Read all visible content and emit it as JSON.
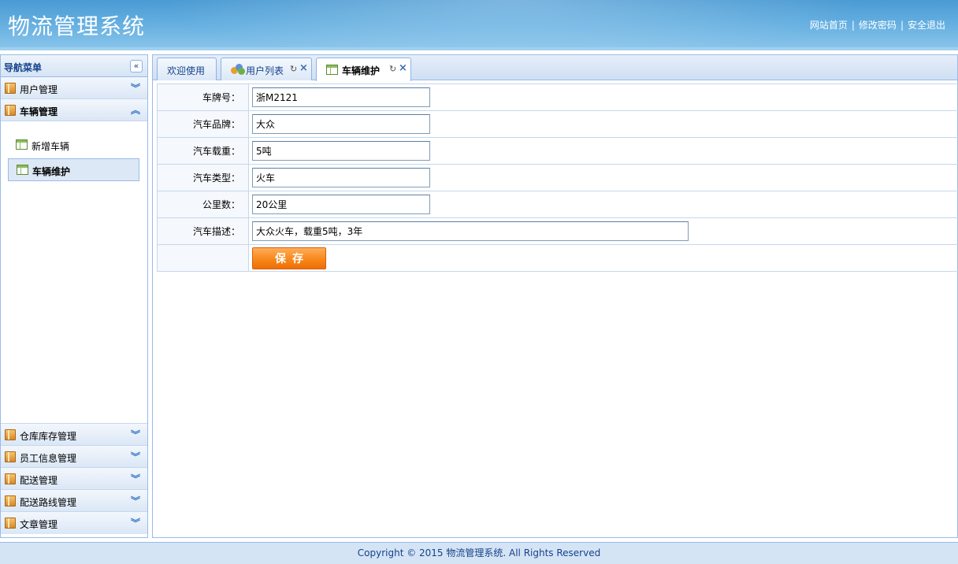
{
  "header": {
    "title": "物流管理系统",
    "links": [
      "网站首页",
      "修改密码",
      "安全退出"
    ],
    "separator": "|"
  },
  "sidebar": {
    "title": "导航菜单",
    "collapse_icon": "«",
    "sections_top": [
      {
        "label": "用户管理",
        "expanded": false
      },
      {
        "label": "车辆管理",
        "expanded": true
      }
    ],
    "open_items": [
      {
        "label": "新增车辆",
        "selected": false
      },
      {
        "label": "车辆维护",
        "selected": true
      }
    ],
    "sections_bottom": [
      {
        "label": "仓库库存管理"
      },
      {
        "label": "员工信息管理"
      },
      {
        "label": "配送管理"
      },
      {
        "label": "配送路线管理"
      },
      {
        "label": "文章管理"
      }
    ],
    "chevron_down": "︾",
    "chevron_up": "︽"
  },
  "tabs": [
    {
      "label": "欢迎使用",
      "closable": false,
      "active": false
    },
    {
      "label": "用户列表",
      "closable": true,
      "active": false
    },
    {
      "label": "车辆维护",
      "closable": true,
      "active": true
    }
  ],
  "tab_icons": {
    "refresh": "↻",
    "close": "×"
  },
  "form": {
    "fields": [
      {
        "label": "车牌号：",
        "value": "浙M2121"
      },
      {
        "label": "汽车品牌：",
        "value": "大众"
      },
      {
        "label": "汽车载重：",
        "value": "5吨"
      },
      {
        "label": "汽车类型：",
        "value": "火车"
      },
      {
        "label": "公里数：",
        "value": "20公里"
      },
      {
        "label": "汽车描述：",
        "value": "大众火车，载重5吨，3年"
      }
    ],
    "save_label": "保存"
  },
  "footer": {
    "text": "Copyright © 2015 物流管理系统. All Rights Reserved"
  },
  "colors": {
    "accent": "#15428b",
    "border": "#99bbe8",
    "save_button": "#f88a1f"
  }
}
